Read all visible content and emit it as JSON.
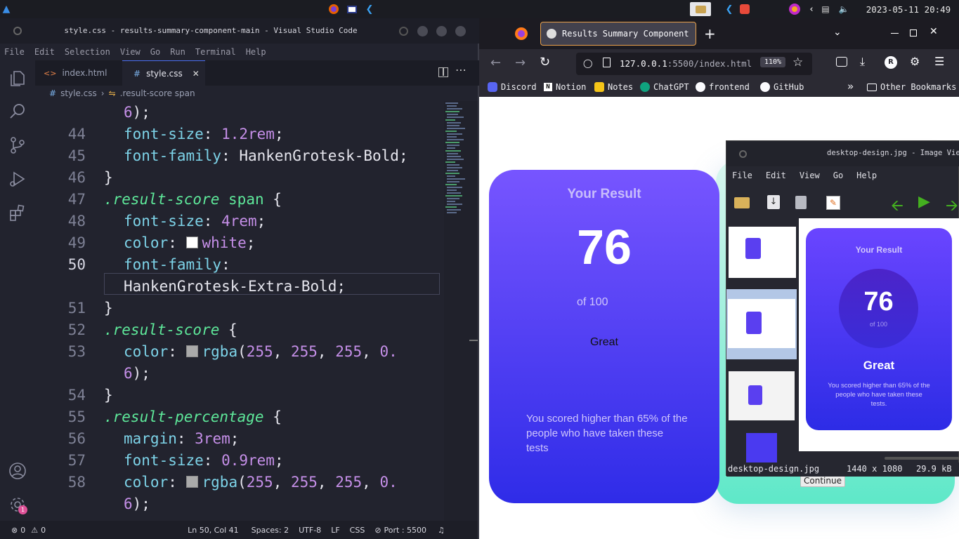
{
  "taskbar": {
    "datetime": "2023-05-11  20:49"
  },
  "vscode": {
    "window_title": "style.css - results-summary-component-main - Visual Studio Code",
    "menu": [
      "File",
      "Edit",
      "Selection",
      "View",
      "Go",
      "Run",
      "Terminal",
      "Help"
    ],
    "tabs": [
      {
        "label": "index.html",
        "icon": "html-icon"
      },
      {
        "label": "style.css",
        "icon": "css-hash-icon",
        "active": true
      }
    ],
    "breadcrumb": {
      "file": "style.css",
      "symbol": "result-score span"
    },
    "lines": [
      {
        "n": "",
        "text": "6);"
      },
      {
        "n": "44",
        "text": "font-size: 1.2rem;"
      },
      {
        "n": "45",
        "text": "font-family: HankenGrotesk-Bold;"
      },
      {
        "n": "46",
        "text": "}"
      },
      {
        "n": "47",
        "text": ".result-score span {"
      },
      {
        "n": "48",
        "text": "font-size: 4rem;"
      },
      {
        "n": "49",
        "text": "color: white;"
      },
      {
        "n": "50",
        "text": "font-family:"
      },
      {
        "n": "",
        "text": "HankenGrotesk-Extra-Bold;"
      },
      {
        "n": "51",
        "text": "}"
      },
      {
        "n": "52",
        "text": ".result-score {"
      },
      {
        "n": "53",
        "text": "color: rgba(255, 255, 255, 0."
      },
      {
        "n": "",
        "text": "6);"
      },
      {
        "n": "54",
        "text": "}"
      },
      {
        "n": "55",
        "text": ".result-percentage {"
      },
      {
        "n": "56",
        "text": "margin: 3rem;"
      },
      {
        "n": "57",
        "text": "font-size: 0.9rem;"
      },
      {
        "n": "58",
        "text": "color: rgba(255, 255, 255, 0."
      },
      {
        "n": "",
        "text": "6);"
      }
    ],
    "status": {
      "errors": "0",
      "warnings": "0",
      "position": "Ln 50, Col 41",
      "spaces": "Spaces: 2",
      "encoding": "UTF-8",
      "eol": "LF",
      "language": "CSS",
      "port": "Port : 5500"
    },
    "colors": {
      "property": "#7dd3e8",
      "value": "#c58fe8",
      "selector": "#5ee89a"
    }
  },
  "firefox": {
    "tab_title": "Results Summary Component",
    "url_host": "127.0.0.1",
    "url_rest": ":5500/index.html",
    "zoom": "110%",
    "profile_initial": "R",
    "bookmarks": [
      "Discord",
      "Notion",
      "Notes",
      "ChatGPT",
      "frontend",
      "GitHub"
    ],
    "other_bookmarks": "Other Bookmarks",
    "page": {
      "heading": "Your Result",
      "score": "76",
      "of_text": "of 100",
      "rating": "Great",
      "summary": "You scored higher than 65% of the people who have taken these tests",
      "button": "Continue"
    }
  },
  "image_viewer": {
    "title": "desktop-design.jpg - Image Viewer",
    "menu": [
      "File",
      "Edit",
      "View",
      "Go",
      "Help"
    ],
    "preview": {
      "heading": "Your Result",
      "score": "76",
      "of_text": "of 100",
      "rating": "Great",
      "summary": "You scored higher than 65% of the people who have taken these tests."
    },
    "status": {
      "filename": "desktop-design.jpg",
      "dimensions": "1440 x 1080",
      "size": "29.9 kB"
    }
  }
}
